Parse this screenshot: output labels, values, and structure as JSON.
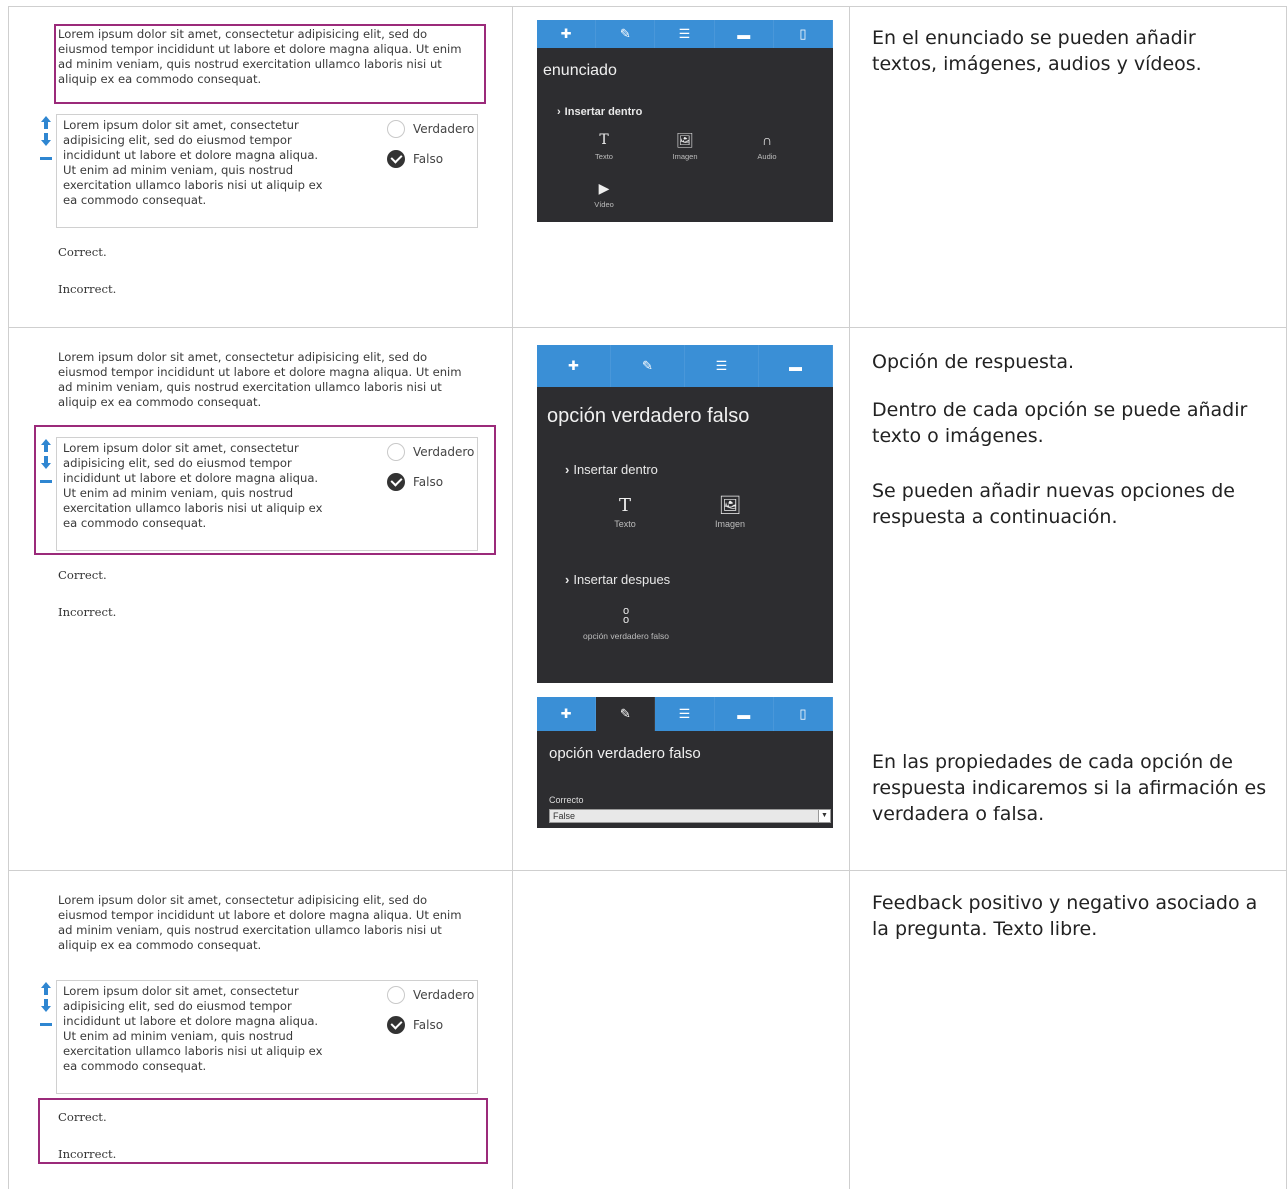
{
  "lorem_short": "Lorem ipsum dolor sit amet, consectetur adipisicing elit, sed do eiusmod tempor incididunt ut labore et dolore magna aliqua. Ut enim ad minim veniam, quis nostrud exercitation ullamco laboris nisi ut aliquip ex ea commodo consequat.",
  "option_text": "Lorem ipsum dolor sit amet, consectetur adipisicing elit, sed do eiusmod tempor incididunt ut labore et dolore magna aliqua. Ut enim ad minim veniam, quis nostrud exercitation ullamco laboris nisi ut aliquip ex ea commodo consequat.",
  "radio_true": "Verdadero",
  "radio_false": "Falso",
  "feedback_correct": "Correct.",
  "feedback_incorrect": "Incorrect.",
  "highlight_color": "#9b2a7a",
  "tab_color": "#3a8fd6",
  "panel1": {
    "title": "enunciado",
    "insert_label": "Insertar dentro",
    "tools": [
      "Texto",
      "Imagen",
      "Audio",
      "Vídeo"
    ]
  },
  "panel2": {
    "title": "opción verdadero falso",
    "insert_inside": "Insertar dentro",
    "tools": [
      "Texto",
      "Imagen"
    ],
    "insert_after": "Insertar despues",
    "after_tool": "opción verdadero falso"
  },
  "panel3": {
    "title": "opción verdadero falso",
    "field_label": "Correcto",
    "field_value": "False"
  },
  "right": {
    "row1": "En el enunciado se pueden añadir textos, imágenes, audios y vídeos.",
    "row2_a": "Opción de respuesta.",
    "row2_b": "Dentro de cada opción se puede añadir texto o imágenes.",
    "row2_c": "Se pueden añadir nuevas opciones de respuesta a continuación.",
    "row2_d": "En las propiedades de cada opción de respuesta indicaremos si la afirmación es verdadera o falsa.",
    "row3": "Feedback positivo y negativo asociado a la pregunta. Texto libre."
  }
}
